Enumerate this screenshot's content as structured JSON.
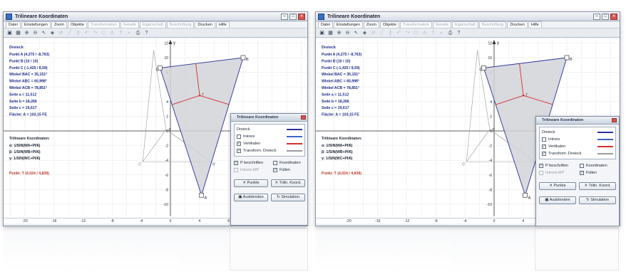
{
  "window": {
    "title": "Trilineare Koordinaten",
    "menu": [
      {
        "label": "Datei",
        "enabled": true
      },
      {
        "label": "Einstellungen",
        "enabled": true
      },
      {
        "label": "Zoom",
        "enabled": true
      },
      {
        "label": "Objekte",
        "enabled": true
      },
      {
        "label": "Transformation",
        "enabled": false
      },
      {
        "label": "Gerade",
        "enabled": false
      },
      {
        "label": "Eigenschaft",
        "enabled": false
      },
      {
        "label": "Beschriftung",
        "enabled": false
      },
      {
        "label": "Drucken",
        "enabled": true
      },
      {
        "label": "Hilfe",
        "enabled": true
      }
    ]
  },
  "info": {
    "heading": "Dreieck",
    "lines": [
      "Punkt A (4,275 / -8,763)",
      "Punkt B (10 / 10)",
      "Punkt C (-1,425 / 8,59)",
      "Winkel BAC = 35,151°",
      "Winkel ABC = 65,998°",
      "Winkel ACB = 78,851°",
      "Seite a = 11,512",
      "Seite b = 18,266",
      "Seite c = 19,617",
      "Fläche: A = 103,15 FE"
    ],
    "lines_right": [
      "Punkt A (4,275 / -8,763)",
      "Punkt B (10 / 10)",
      "Punkt C (-1,425 / 8,59)",
      "Winkel BAC = 35,151°",
      "Winkel ABC = 65,998°",
      "Winkel ACB = 78,851°",
      "Seite a = 11,512",
      "Seite b = 18,266",
      "Seite c = 19,617",
      "Fläche: A = 103,15 FE"
    ],
    "tri_heading": "Trilineare Koordinaten:",
    "tri_lines": [
      "α:  1/SIN(WA+PI/6)",
      "β:  1/SIN(WB+PI/6)",
      "γ:  1/SIN(WC+PI/6)"
    ],
    "point_t": "Punkt: T (4,024 / 4,838)"
  },
  "axes": {
    "x_ticks": [
      "-20",
      "-16",
      "-12",
      "-8",
      "-4",
      "0",
      "4",
      "8",
      "12",
      "16",
      "20"
    ],
    "y_ticks": [
      "12",
      "10",
      "8",
      "6",
      "4",
      "2",
      "0",
      "-2",
      "-4",
      "-6",
      "-8",
      "-10"
    ],
    "x_label": "x",
    "y_label": "y"
  },
  "points": {
    "A": "A",
    "B": "B",
    "C": "C",
    "A2": "A'",
    "B2": "B'",
    "C2": "C'",
    "T": "T"
  },
  "panel": {
    "title": "Trilineare Koordinaten",
    "items": [
      {
        "label": "Dreieck",
        "checkbox": false,
        "checked": false,
        "color": "#2b2f9a"
      },
      {
        "label": "Inkreis",
        "checkbox": true,
        "checked": false,
        "color": "#3e63c9"
      },
      {
        "label": "Vertikalen",
        "checkbox": true,
        "checked": true,
        "color": "#d23030"
      },
      {
        "label": "Transform. Dreieck",
        "checkbox": true,
        "checked": true,
        "color": "#9a9a9a"
      }
    ],
    "opt_p": "P beschriften",
    "opt_koord": "Koordinaten",
    "opt_inkreis_mp": "Inkreis-MP",
    "opt_fuellen": "Füllen",
    "btn_punkte": "Punkte",
    "btn_trilin": "Trilin. Koord.",
    "btn_ausblenden": "Ausblenden",
    "btn_simulation": "Simulation"
  },
  "colors": {
    "triangle": "#2b2f9a",
    "fill": "#d2d4d8",
    "vertical": "#d23030",
    "transformed": "#9a9a9a",
    "grid": "#e6e6e6"
  }
}
